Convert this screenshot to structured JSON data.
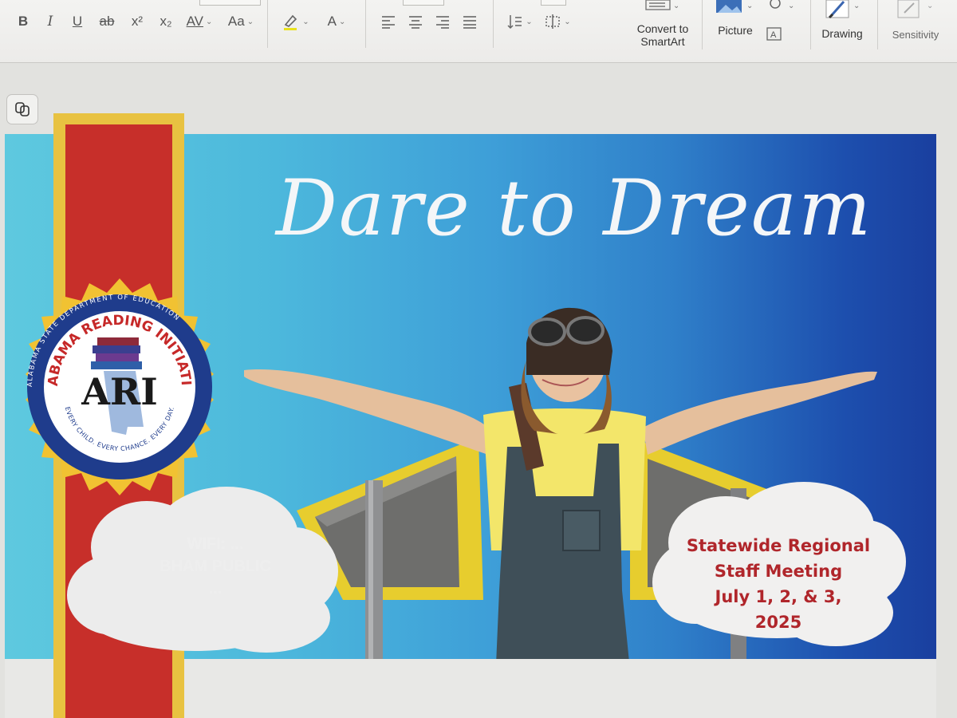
{
  "toolbar": {
    "format_buttons": [
      "B",
      "I",
      "U",
      "ab",
      "x²",
      "x₂",
      "AV",
      "Aa",
      "A"
    ],
    "convert_smartart": [
      "Convert to",
      "SmartArt"
    ],
    "picture_label": "Picture",
    "drawing_label": "Drawing",
    "sensitivity_label": "Sensitivity"
  },
  "slide": {
    "title": "Dare to Dream",
    "seal": {
      "org_top": "ALABAMA READING INITIATIVE",
      "acronym": "ARI",
      "motto": "EVERY CHILD. EVERY CHANCE. EVERY DAY.",
      "outer_ring": "ALABAMA STATE DEPARTMENT OF EDUCATION"
    },
    "left_cloud_faded": [
      "WIFI: ...",
      "BHAM PUBLIC",
      "..."
    ],
    "event": {
      "line1": "Statewide Regional",
      "line2": "Staff Meeting",
      "line3": "July 1, 2, & 3,",
      "line4": "2025"
    }
  },
  "colors": {
    "banner_red": "#c72f2a",
    "banner_gold": "#e8c241",
    "seal_navy": "#1f3c8c",
    "event_text": "#b0262b"
  }
}
